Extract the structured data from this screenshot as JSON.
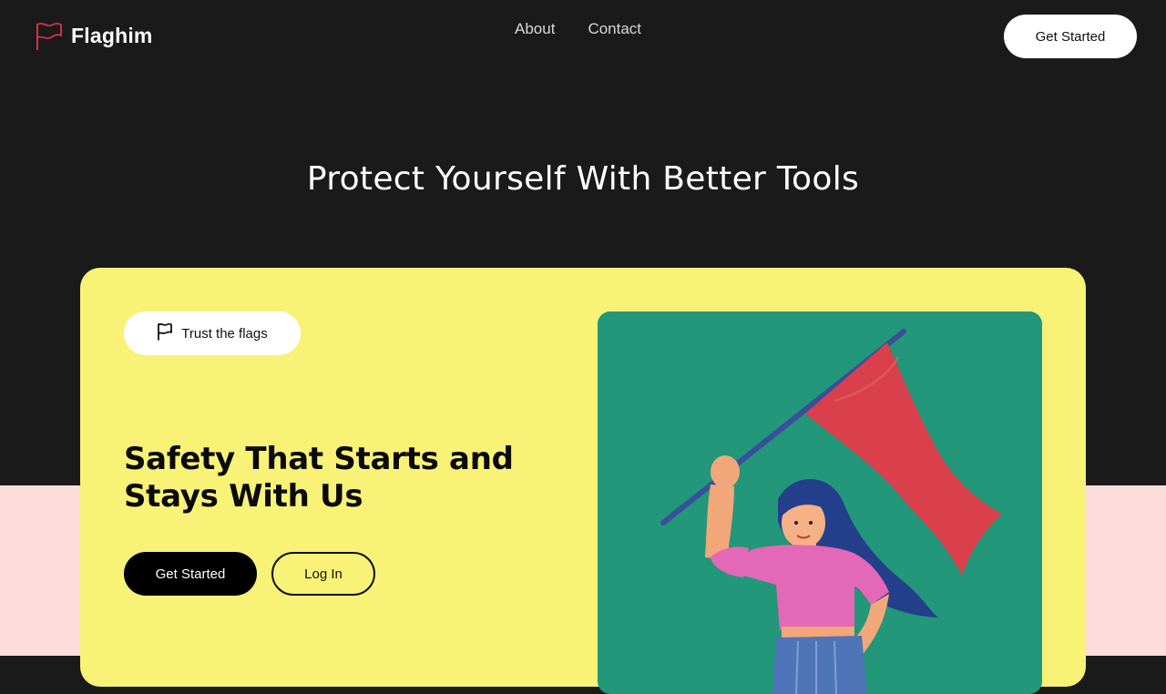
{
  "brand": {
    "name": "Flaghim",
    "logo_color": "#d9304a"
  },
  "nav": {
    "items": [
      {
        "label": "About"
      },
      {
        "label": "Contact"
      }
    ]
  },
  "header": {
    "cta_label": "Get Started"
  },
  "hero": {
    "heading": "Protect Yourself With Better Tools"
  },
  "card": {
    "badge_label": "Trust the flags",
    "badge_icon": "flag-icon",
    "title": "Safety That Starts and Stays With Us",
    "primary_label": "Get Started",
    "secondary_label": "Log In",
    "illustration": "woman-holding-red-flag"
  },
  "colors": {
    "page_background": "#1a1a1a",
    "card_background": "#f8f277",
    "pink_band": "#fddcdc",
    "illustration_background": "#22977a",
    "flag_red": "#d9404b"
  }
}
